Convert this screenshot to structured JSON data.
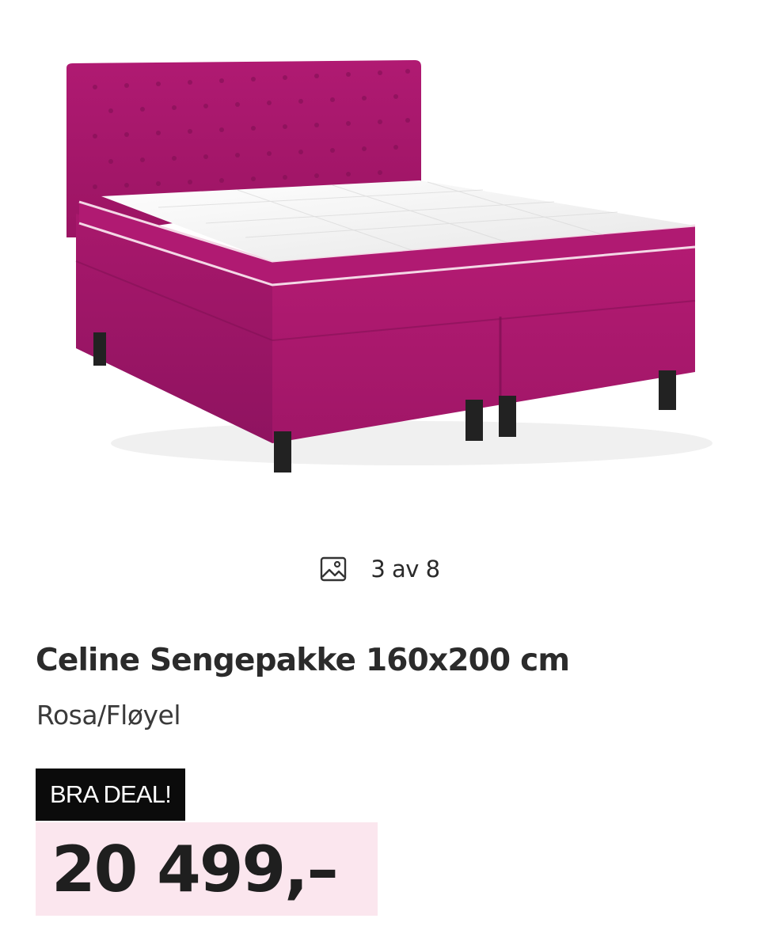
{
  "gallery": {
    "image_alt": "Celine Sengepakke 160x200 cm Rosa/Fløyel",
    "counter_text": "3 av 8",
    "counter_icon": "image-icon"
  },
  "product": {
    "title": "Celine Sengepakke 160x200 cm",
    "variant": "Rosa/Fløyel"
  },
  "deal_badge": "BRA DEAL!",
  "price": "20 499,–",
  "colors": {
    "bed_fabric": "#b21a72",
    "price_background": "#fbe6ee",
    "badge_background": "#0b0b0b"
  }
}
